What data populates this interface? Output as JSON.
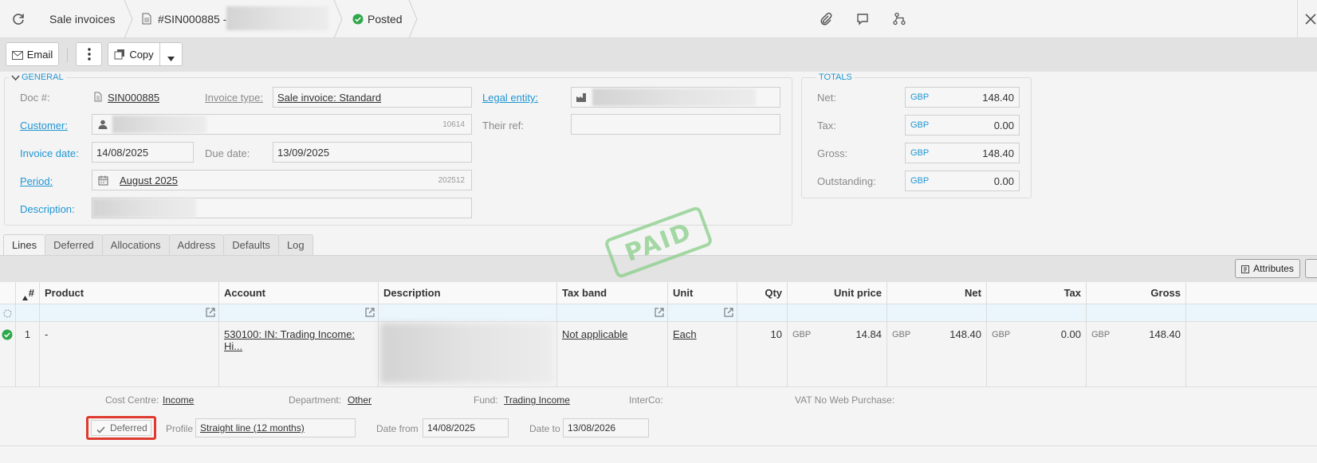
{
  "header": {
    "breadcrumb_root": "Sale invoices",
    "doc_ref": "#SIN000885 -",
    "status": "Posted"
  },
  "toolbar": {
    "email_label": "Email",
    "copy_label": "Copy"
  },
  "general": {
    "legend": "GENERAL",
    "doc_label": "Doc #:",
    "doc_value": "SIN000885",
    "invoice_type_label": "Invoice type:",
    "invoice_type_value": "Sale invoice: Standard",
    "legal_entity_label": "Legal entity:",
    "customer_label": "Customer:",
    "customer_code": "10614",
    "their_ref_label": "Their ref:",
    "invoice_date_label": "Invoice date:",
    "invoice_date_value": "14/08/2025",
    "due_date_label": "Due date:",
    "due_date_value": "13/09/2025",
    "period_label": "Period:",
    "period_value": "August 2025",
    "period_code": "202512",
    "description_label": "Description:"
  },
  "totals": {
    "legend": "TOTALS",
    "rows": [
      {
        "label": "Net:",
        "currency": "GBP",
        "amount": "148.40"
      },
      {
        "label": "Tax:",
        "currency": "GBP",
        "amount": "0.00"
      },
      {
        "label": "Gross:",
        "currency": "GBP",
        "amount": "148.40"
      },
      {
        "label": "Outstanding:",
        "currency": "GBP",
        "amount": "0.00"
      }
    ]
  },
  "stamp": "PAID",
  "tabs": [
    "Lines",
    "Deferred",
    "Allocations",
    "Address",
    "Defaults",
    "Log"
  ],
  "grid": {
    "attributes_label": "Attributes",
    "columns": [
      "#",
      "Product",
      "Account",
      "Description",
      "Tax band",
      "Unit",
      "Qty",
      "Unit price",
      "Net",
      "Tax",
      "Gross"
    ],
    "row": {
      "num": "1",
      "product": "-",
      "account": "530100: IN: Trading Income: Hi...",
      "tax_band": "Not applicable",
      "unit": "Each",
      "qty": "10",
      "unit_price_cur": "GBP",
      "unit_price": "14.84",
      "net_cur": "GBP",
      "net": "148.40",
      "tax_cur": "GBP",
      "tax": "0.00",
      "gross_cur": "GBP",
      "gross": "148.40"
    },
    "details": {
      "cost_centre_label": "Cost Centre:",
      "cost_centre_value": "Income",
      "department_label": "Department:",
      "department_value": "Other",
      "fund_label": "Fund:",
      "fund_value": "Trading Income",
      "interco_label": "InterCo:",
      "vat_label": "VAT No Web Purchase:",
      "deferred_label": "Deferred",
      "profile_label": "Profile",
      "profile_value": "Straight line (12 months)",
      "date_from_label": "Date from",
      "date_from_value": "14/08/2025",
      "date_to_label": "Date to",
      "date_to_value": "13/08/2026"
    }
  },
  "colors": {
    "accent": "#1f96d3",
    "posted": "#2ea84a",
    "stamp": "#8fd08f",
    "highlight": "#e03a2e"
  }
}
